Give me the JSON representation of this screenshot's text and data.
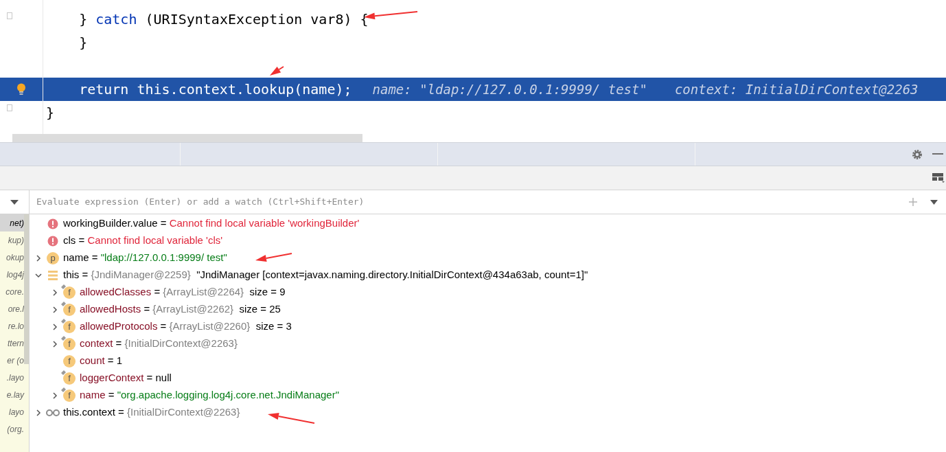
{
  "editor": {
    "lines": [
      {
        "current": false,
        "tokens": [
          {
            "kind": "plain",
            "text": "    } "
          },
          {
            "kind": "keyword",
            "text": "catch"
          },
          {
            "kind": "plain",
            "text": " (URISyntaxException var8) {"
          }
        ]
      },
      {
        "current": false,
        "tokens": [
          {
            "kind": "plain",
            "text": "    }"
          }
        ]
      },
      {
        "current": false
      },
      {
        "current": true,
        "tokens": [
          {
            "kind": "plain",
            "text": "    return this.context.lookup(name);"
          }
        ],
        "hints": [
          "name: \"ldap://127.0.0.1:9999/ test\"",
          "context: InitialDirContext@2263"
        ]
      },
      {
        "current": false,
        "tokens": [
          {
            "kind": "plain",
            "text": "}"
          }
        ]
      }
    ]
  },
  "frames": {
    "items": [
      {
        "text": "net)",
        "selected": true
      },
      {
        "text": "kup)",
        "selected": false
      },
      {
        "text": "okup",
        "selected": false
      },
      {
        "text": "log4j",
        "selected": false
      },
      {
        "text": "core.",
        "selected": false
      },
      {
        "text": "ore.l",
        "selected": false
      },
      {
        "text": "re.lo",
        "selected": false
      },
      {
        "text": "ttern",
        "selected": false
      },
      {
        "text": "er (o",
        "selected": false
      },
      {
        "text": ".layo",
        "selected": false
      },
      {
        "text": "e.lay",
        "selected": false
      },
      {
        "text": "layo",
        "selected": false
      },
      {
        "text": "(org.",
        "selected": false
      }
    ]
  },
  "evaluate": {
    "placeholder": "Evaluate expression (Enter) or add a watch (Ctrl+Shift+Enter)"
  },
  "variables": [
    {
      "kind": "error",
      "expandable": false,
      "name": "workingBuilder.value",
      "operator": "=",
      "value": {
        "kind": "error",
        "text": "Cannot find local variable 'workingBuilder'"
      }
    },
    {
      "kind": "error",
      "expandable": false,
      "name": "cls",
      "operator": "=",
      "value": {
        "kind": "error",
        "text": "Cannot find local variable 'cls'"
      }
    },
    {
      "kind": "param",
      "badge": "p",
      "expandable": true,
      "expanded": false,
      "name": "name",
      "operator": "=",
      "value": {
        "kind": "string",
        "text": "\"ldap://127.0.0.1:9999/ test\""
      }
    },
    {
      "kind": "object",
      "expandable": true,
      "expanded": true,
      "name": "this",
      "operator": "=",
      "ref": "{JndiManager@2259}",
      "value": {
        "kind": "plain",
        "text": "\"JndiManager [context=javax.naming.directory.InitialDirContext@434a63ab, count=1]\""
      },
      "children": [
        {
          "kind": "field",
          "badge": "f",
          "final": true,
          "expandable": true,
          "expanded": false,
          "name": "allowedClasses",
          "operator": "=",
          "ref": "{ArrayList@2264}",
          "value": {
            "kind": "plain",
            "text": "size = 9"
          }
        },
        {
          "kind": "field",
          "badge": "f",
          "final": true,
          "expandable": true,
          "expanded": false,
          "name": "allowedHosts",
          "operator": "=",
          "ref": "{ArrayList@2262}",
          "value": {
            "kind": "plain",
            "text": "size = 25"
          }
        },
        {
          "kind": "field",
          "badge": "f",
          "final": true,
          "expandable": true,
          "expanded": false,
          "name": "allowedProtocols",
          "operator": "=",
          "ref": "{ArrayList@2260}",
          "value": {
            "kind": "plain",
            "text": "size = 3"
          }
        },
        {
          "kind": "field",
          "badge": "f",
          "final": true,
          "expandable": true,
          "expanded": false,
          "name": "context",
          "operator": "=",
          "ref": "{InitialDirContext@2263}"
        },
        {
          "kind": "field",
          "badge": "f",
          "final": false,
          "expandable": false,
          "name": "count",
          "operator": "=",
          "value": {
            "kind": "plain",
            "text": "1"
          }
        },
        {
          "kind": "field",
          "badge": "f",
          "final": true,
          "expandable": false,
          "name": "loggerContext",
          "operator": "=",
          "value": {
            "kind": "plain",
            "text": "null"
          }
        },
        {
          "kind": "field",
          "badge": "f",
          "final": true,
          "expandable": true,
          "expanded": false,
          "name": "name",
          "operator": "=",
          "value": {
            "kind": "string",
            "text": "\"org.apache.logging.log4j.core.net.JndiManager\""
          }
        }
      ]
    },
    {
      "kind": "watch",
      "expandable": true,
      "expanded": false,
      "name": "this.context",
      "operator": "=",
      "ref": "{InitialDirContext@2263}"
    }
  ]
}
